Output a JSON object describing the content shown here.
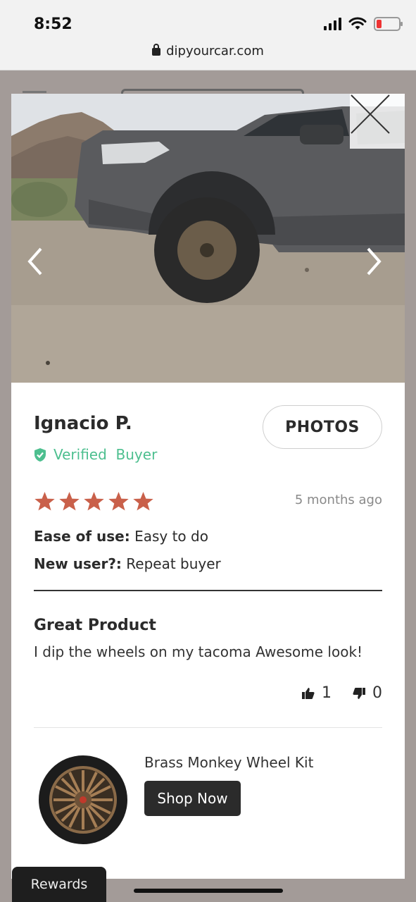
{
  "status_bar": {
    "time": "8:52"
  },
  "browser": {
    "url": "dipyourcar.com"
  },
  "review": {
    "reviewer_name": "Ignacio P.",
    "verified_label": "Verified  Buyer",
    "photos_button": "PHOTOS",
    "rating": 5,
    "rating_max": 5,
    "date": "5 months ago",
    "attributes": [
      {
        "label": "Ease of use:",
        "value": "Easy to do"
      },
      {
        "label": "New user?:",
        "value": "Repeat buyer"
      }
    ],
    "title": "Great Product",
    "body": "I dip the wheels on my tacoma Awesome look!",
    "upvotes": "1",
    "downvotes": "0"
  },
  "product": {
    "name": "Brass Monkey Wheel Kit",
    "cta": "Shop Now"
  },
  "rewards_tab": "Rewards",
  "colors": {
    "star": "#c9604a",
    "verified": "#4dbf8f",
    "button_dark": "#2b2b2b",
    "overlay": "#a39b98"
  },
  "icons": [
    "lock-icon",
    "close-icon",
    "chevron-left-icon",
    "chevron-right-icon",
    "shield-check-icon",
    "star-icon",
    "thumbs-up-icon",
    "thumbs-down-icon"
  ]
}
